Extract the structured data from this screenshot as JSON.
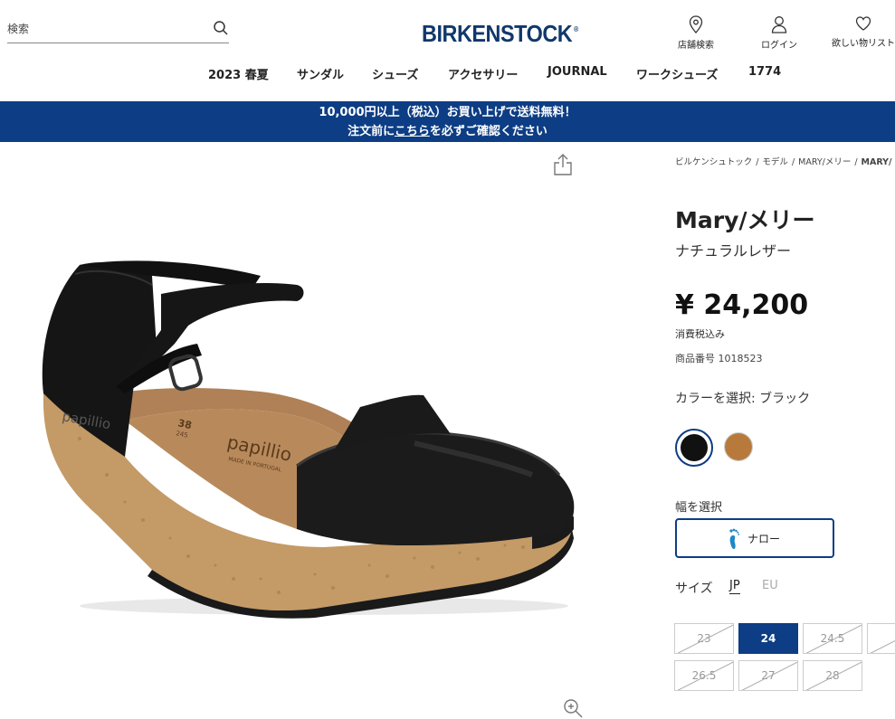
{
  "header": {
    "search_placeholder": "検索",
    "logo": "BIRKENSTOCK",
    "logo_mark": "®",
    "tools": {
      "store_locator": "店舗検索",
      "login": "ログイン",
      "wishlist": "欲しい物リスト"
    }
  },
  "nav": {
    "items": [
      "2023 春夏",
      "サンダル",
      "シューズ",
      "アクセサリー",
      "JOURNAL",
      "ワークシューズ",
      "1774"
    ]
  },
  "banner": {
    "line1": "10,000円以上（税込）お買い上げで送料無料！",
    "line2_pre": "注文前に",
    "line2_link": "こちら",
    "line2_post": "を必ずご確認ください"
  },
  "breadcrumb": {
    "items": [
      "ビルケンシュトック",
      "モデル",
      "MARY/メリー"
    ],
    "current": "MARY/"
  },
  "product": {
    "title": "Mary/メリー",
    "material": "ナチュラルレザー",
    "price": "¥ 24,200",
    "tax_note": "消費税込み",
    "sku": "商品番号 1018523",
    "color_label": "カラーを選択: ブラック",
    "colors": [
      {
        "name": "black",
        "hex": "#111111",
        "selected": true
      },
      {
        "name": "tan",
        "hex": "#b87a3c",
        "selected": false
      }
    ],
    "width_label": "幅を選択",
    "width_option": "ナロー",
    "size_label": "サイズ",
    "size_systems": [
      "JP",
      "EU"
    ],
    "sizes": [
      {
        "label": "23",
        "available": false,
        "selected": false
      },
      {
        "label": "24",
        "available": true,
        "selected": true
      },
      {
        "label": "24.5",
        "available": false,
        "selected": false
      },
      {
        "label": "",
        "available": false,
        "selected": false
      },
      {
        "label": "26.5",
        "available": false,
        "selected": false
      },
      {
        "label": "27",
        "available": false,
        "selected": false
      },
      {
        "label": "28",
        "available": true,
        "selected": false
      }
    ]
  },
  "image": {
    "insole_brand": "papillio",
    "insole_size_top": "38",
    "insole_size_bottom": "245",
    "insole_made": "MADE IN PORTUGAL",
    "heel_brand": "papillio"
  },
  "colors": {
    "brand_blue": "#0d3d84",
    "logo_blue": "#10386b"
  }
}
